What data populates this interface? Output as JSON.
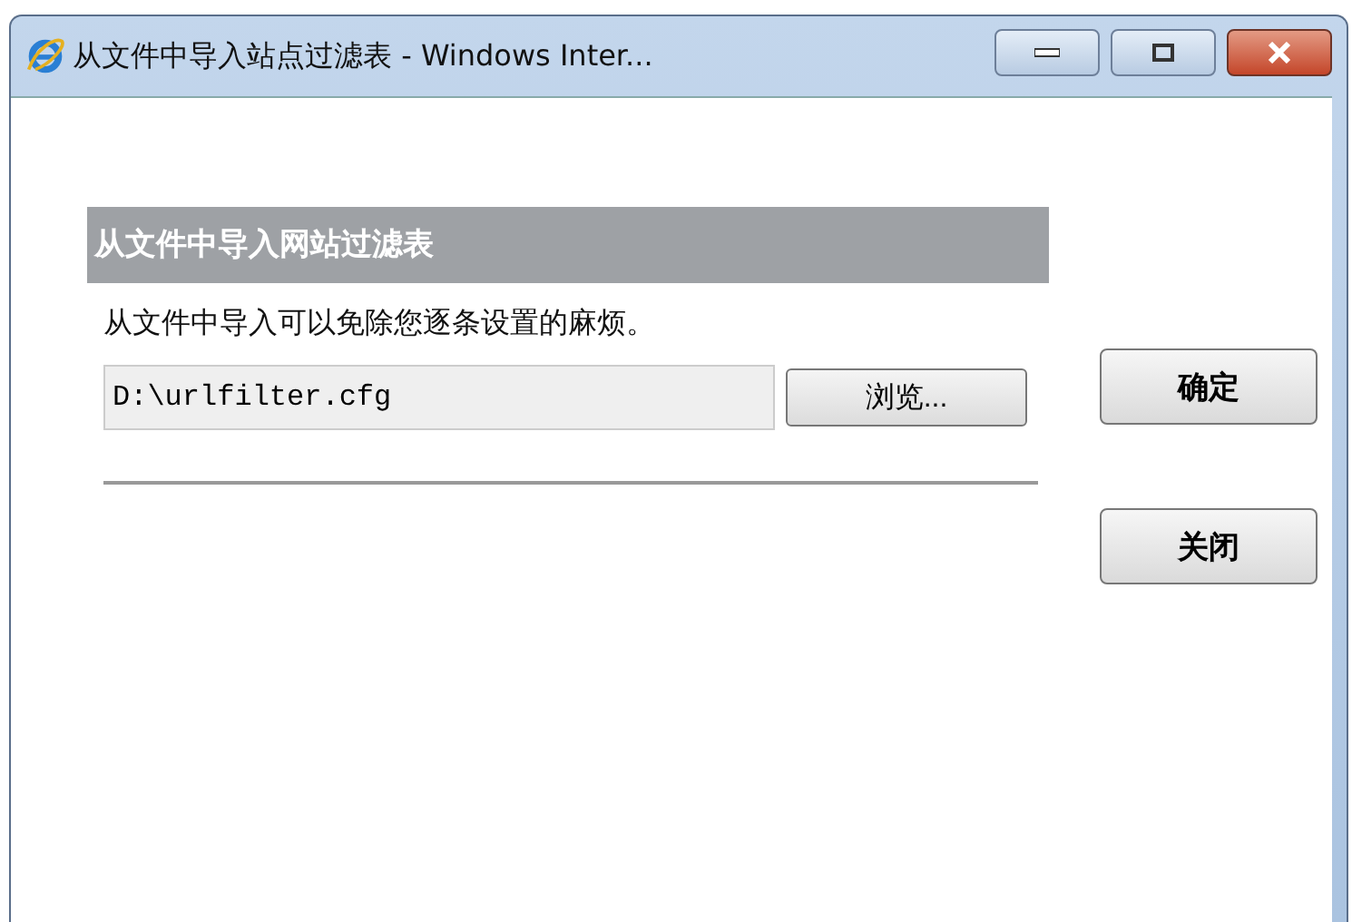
{
  "window": {
    "title": "从文件中导入站点过滤表 - Windows Inter..."
  },
  "section": {
    "heading": "从文件中导入网站过滤表",
    "description": "从文件中导入可以免除您逐条设置的麻烦。",
    "file_field": {
      "value": "D:\\urlfilter.cfg"
    },
    "browse_button": "浏览..."
  },
  "buttons": [
    {
      "label": "确定"
    },
    {
      "label": "关闭"
    }
  ]
}
